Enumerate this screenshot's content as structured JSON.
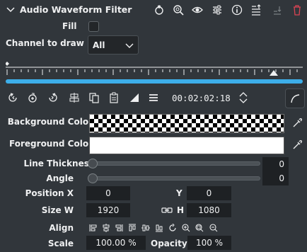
{
  "header": {
    "title": "Audio Waveform Filter",
    "icons": [
      "collapse-chevron-icon",
      "reset-icon",
      "zoom-icon",
      "visibility-icon",
      "settings-sliders-icon",
      "info-icon",
      "keyframes-icon",
      "move-down-icon",
      "delete-icon"
    ],
    "accent_delete": "#da4453"
  },
  "fill": {
    "label": "Fill",
    "checked": false
  },
  "channel": {
    "label": "Channel to draw",
    "value": "All"
  },
  "timeline": {
    "progress_fraction": 1.0,
    "accent": "#3daee9"
  },
  "toolbar": {
    "timecode": "00:02:02:18",
    "icons": [
      "rewind-keyframe-icon",
      "add-keyframe-icon",
      "forward-keyframe-icon",
      "align-icon",
      "copy-icon",
      "paste-icon",
      "ramp-icon",
      "menu-icon",
      "stepper-icon",
      "curve-icon"
    ]
  },
  "background_color": {
    "label": "Background Color",
    "value": "transparent"
  },
  "foreground_color": {
    "label": "Foreground Color",
    "value": "#ffffff"
  },
  "line_thickness": {
    "label": "Line Thickness",
    "value": "0",
    "fraction": 0
  },
  "angle": {
    "label": "Angle",
    "value": "0",
    "fraction": 0
  },
  "position": {
    "x_label": "Position X",
    "x_value": "0",
    "y_label": "Y",
    "y_value": "0"
  },
  "size": {
    "w_label": "Size W",
    "w_value": "1920",
    "h_label": "H",
    "h_value": "1080"
  },
  "align": {
    "label": "Align"
  },
  "scale": {
    "label": "Scale",
    "value": "100.00 %"
  },
  "opacity": {
    "label": "Opacity",
    "value": "100 %"
  }
}
